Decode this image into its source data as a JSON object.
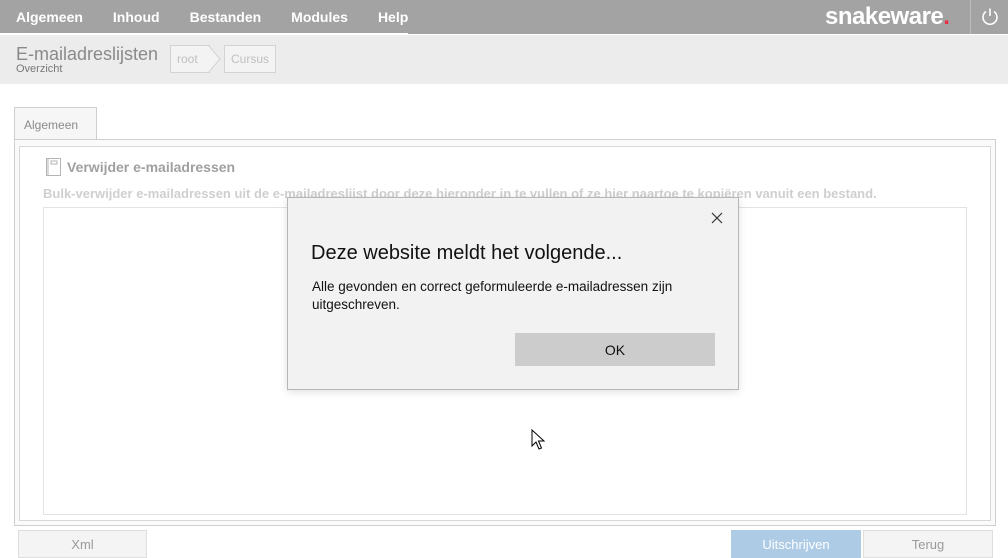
{
  "nav": {
    "items": [
      {
        "label": "Algemeen"
      },
      {
        "label": "Inhoud"
      },
      {
        "label": "Bestanden"
      },
      {
        "label": "Modules"
      },
      {
        "label": "Help"
      }
    ],
    "logo_text": "snakeware",
    "logo_dot": ".",
    "power_icon": "power-icon"
  },
  "header": {
    "title": "E-mailadreslijsten",
    "subtitle": "Overzicht",
    "breadcrumb": [
      {
        "label": "root"
      },
      {
        "label": "Cursus"
      }
    ]
  },
  "tabs": [
    {
      "label": "Algemeen"
    }
  ],
  "section": {
    "icon": "document-icon",
    "title": "Verwijder e-mailadressen",
    "description": "Bulk-verwijder e-mailadressen uit de e-mailadreslijst door deze hieronder in te vullen of ze hier naartoe te kopiëren vanuit een bestand.",
    "textarea_value": ""
  },
  "buttons": {
    "xml": "Xml",
    "uitschrijven": "Uitschrijven",
    "terug": "Terug"
  },
  "dialog": {
    "title": "Deze website meldt het volgende...",
    "message": "Alle gevonden en correct geformuleerde e-mailadressen zijn uitgeschreven.",
    "ok": "OK",
    "close_icon": "close-icon"
  },
  "colors": {
    "topbar": "#a3a3a3",
    "logo_accent": "#e8334a",
    "primary_button": "#aecbe5"
  }
}
